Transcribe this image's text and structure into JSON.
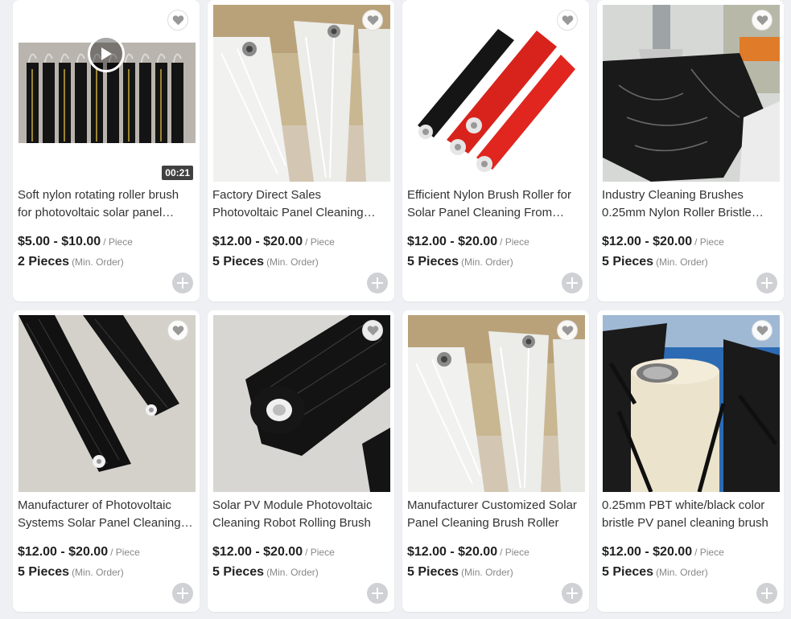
{
  "products": [
    {
      "title": "Soft nylon rotating roller brush for photovoltaic solar panel cleaning",
      "price": "$5.00 - $10.00",
      "price_unit": "/ Piece",
      "min_qty": "2 Pieces",
      "min_label": "(Min. Order)",
      "video_duration": "00:21",
      "image": "black nylon roller brushes hanging on rack, video"
    },
    {
      "title": "Factory Direct Sales Photovoltaic Panel Cleaning Brush",
      "price": "$12.00 - $20.00",
      "price_unit": "/ Piece",
      "min_qty": "5 Pieces",
      "min_label": "(Min. Order)",
      "image": "white roller brushes"
    },
    {
      "title": "Efficient Nylon Brush Roller for Solar Panel Cleaning From Factory",
      "price": "$12.00 - $20.00",
      "price_unit": "/ Piece",
      "min_qty": "5 Pieces",
      "min_label": "(Min. Order)",
      "image": "black and red roller brushes"
    },
    {
      "title": "Industry Cleaning Brushes 0.25mm Nylon Roller Bristle Brush",
      "price": "$12.00 - $20.00",
      "price_unit": "/ Piece",
      "min_qty": "5 Pieces",
      "min_label": "(Min. Order)",
      "image": "black bristle roller on metal shaft"
    },
    {
      "title": "Manufacturer of Photovoltaic Systems Solar Panel Cleaning Brush",
      "price": "$12.00 - $20.00",
      "price_unit": "/ Piece",
      "min_qty": "5 Pieces",
      "min_label": "(Min. Order)",
      "image": "two black roller brushes on floor"
    },
    {
      "title": "Solar PV Module Photovoltaic Cleaning Robot Rolling Brush",
      "price": "$12.00 - $20.00",
      "price_unit": "/ Piece",
      "min_qty": "5 Pieces",
      "min_label": "(Min. Order)",
      "image": "black roller brush end view"
    },
    {
      "title": "Manufacturer Customized Solar Panel Cleaning Brush Roller",
      "price": "$12.00 - $20.00",
      "price_unit": "/ Piece",
      "min_qty": "5 Pieces",
      "min_label": "(Min. Order)",
      "image": "white roller brushes"
    },
    {
      "title": "0.25mm PBT white/black color bristle PV panel cleaning brush",
      "price": "$12.00 - $20.00",
      "price_unit": "/ Piece",
      "min_qty": "5 Pieces",
      "min_label": "(Min. Order)",
      "image": "black bristles on white core closeup"
    }
  ],
  "colors": {
    "background": "#eef0f3",
    "card": "#ffffff",
    "add_button": "#cfd1d4"
  }
}
